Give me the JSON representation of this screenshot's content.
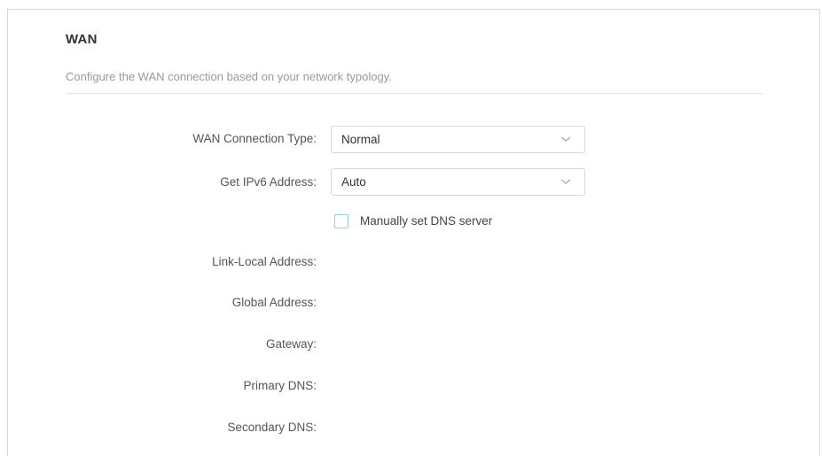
{
  "wan": {
    "title": "WAN",
    "description": "Configure the WAN connection based on your network typology.",
    "connection_type": {
      "label": "WAN Connection Type:",
      "value": "Normal"
    },
    "ipv6_address": {
      "label": "Get IPv6 Address:",
      "value": "Auto"
    },
    "manual_dns": {
      "label": "Manually set DNS server",
      "checked": false
    },
    "info": {
      "link_local_label": "Link-Local Address:",
      "global_address_label": "Global Address:",
      "gateway_label": "Gateway:",
      "primary_dns_label": "Primary DNS:",
      "secondary_dns_label": "Secondary DNS:"
    }
  },
  "icons": {
    "dropdown": "chevron-down-icon",
    "checkbox": "checkbox-unchecked"
  },
  "colors": {
    "checkbox_border": "#8fd3d8",
    "label_text": "#555555",
    "description_text": "#999999"
  }
}
